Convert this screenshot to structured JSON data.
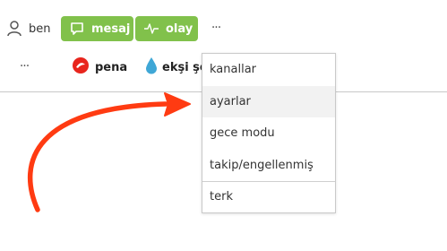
{
  "header": {
    "user_label": "ben",
    "buttons": [
      {
        "label": "mesaj",
        "icon": "speech-bubble-icon"
      },
      {
        "label": "olay",
        "icon": "pulse-icon"
      }
    ],
    "more_label": "···"
  },
  "channels": {
    "more_label": "···",
    "items": [
      {
        "label": "pena",
        "icon": "pena-logo-icon"
      },
      {
        "label": "ekşi şe",
        "icon": "water-drop-icon"
      }
    ]
  },
  "dropdown": {
    "items": [
      {
        "label": "kanallar"
      },
      {
        "label": "ayarlar",
        "highlighted": true
      },
      {
        "label": "gece modu"
      },
      {
        "label": "takip/engellenmiş"
      },
      {
        "label": "terk"
      }
    ]
  },
  "colors": {
    "accent_green": "#81c14b",
    "arrow_red": "#ff3b12",
    "pena_red": "#e8251d",
    "drop_blue": "#3fa7d6"
  }
}
